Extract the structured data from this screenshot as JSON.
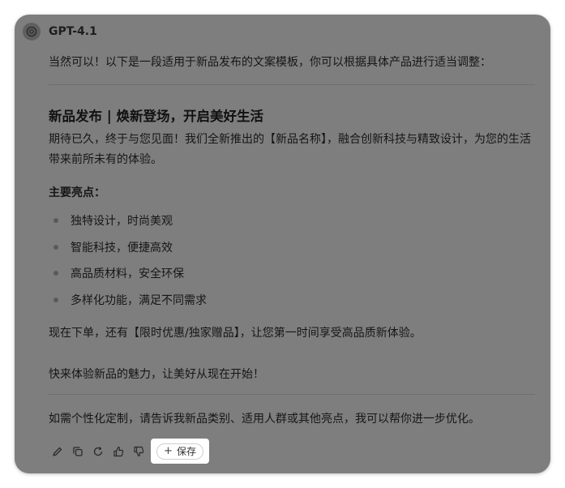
{
  "header": {
    "model_name": "GPT-4.1",
    "logo_icon": "openai-logo-icon"
  },
  "message": {
    "intro": "当然可以！以下是一段适用于新品发布的文案模板，你可以根据具体产品进行适当调整：",
    "heading": "新品发布 | 焕新登场，开启美好生活",
    "paragraph1": "期待已久，终于与您见面！我们全新推出的【新品名称】，融合创新科技与精致设计，为您的生活带来前所未有的体验。",
    "highlights_title": "主要亮点：",
    "highlights": [
      "独特设计，时尚美观",
      "智能科技，便捷高效",
      "高品质材料，安全环保",
      "多样化功能，满足不同需求"
    ],
    "paragraph2": "现在下单，还有【限时优惠/独家赠品】，让您第一时间享受高品质新体验。",
    "paragraph3": "快来体验新品的魅力，让美好从现在开始！",
    "closing": "如需个性化定制，请告诉我新品类别、适用人群或其他亮点，我可以帮你进一步优化。"
  },
  "toolbar": {
    "icons": [
      "edit-icon",
      "copy-icon",
      "regenerate-icon",
      "thumbs-up-icon",
      "thumbs-down-icon"
    ],
    "save_label": "保存",
    "save_icon": "plus-icon"
  },
  "colors": {
    "overlay": "#7e7e7e",
    "highlight": "#ffffff"
  }
}
